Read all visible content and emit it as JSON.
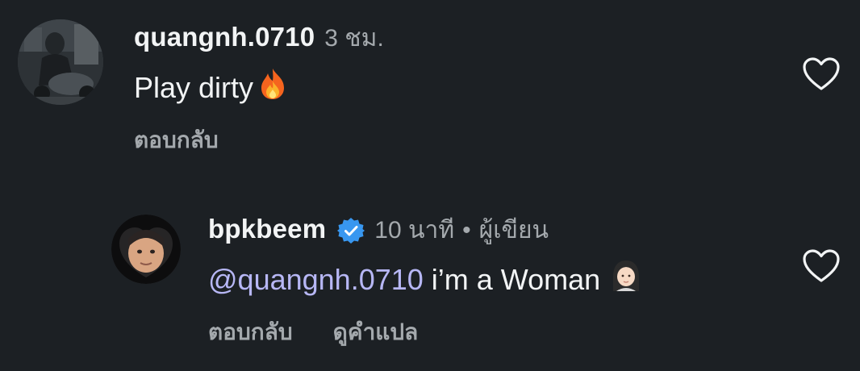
{
  "comments": [
    {
      "username": "quangnh.0710",
      "time": "3 ชม.",
      "text": "Play dirty",
      "emoji": "fire",
      "actions": {
        "reply": "ตอบกลับ"
      }
    },
    {
      "username": "bpkbeem",
      "verified": true,
      "time": "10 นาที",
      "separator": "•",
      "author_tag": "ผู้เขียน",
      "mention": "@quangnh.0710",
      "text": "i’m a Woman",
      "emoji": "woman",
      "actions": {
        "reply": "ตอบกลับ",
        "translate": "ดูคำแปล"
      }
    }
  ],
  "icons": {
    "like": "heart-outline-icon",
    "verified": "verified-badge-icon",
    "verified_color": "#3897f0",
    "mention_color": "#b7b7f5"
  }
}
